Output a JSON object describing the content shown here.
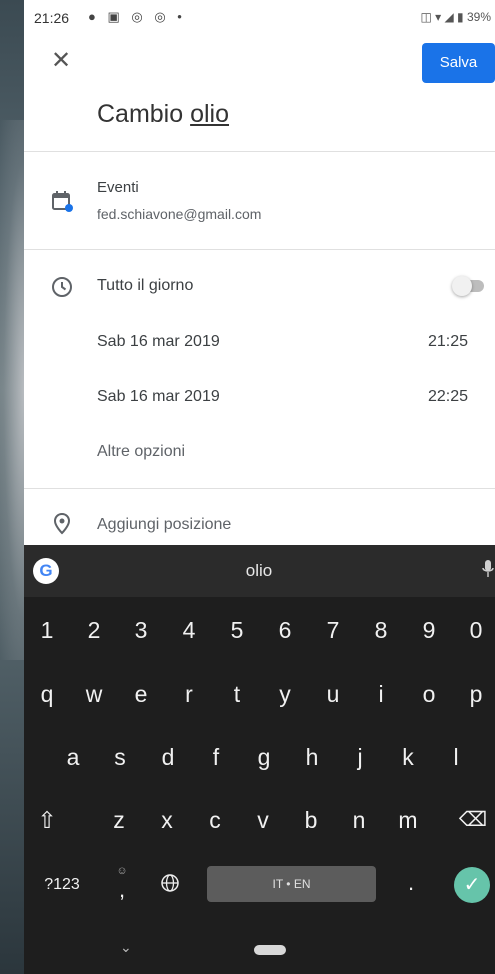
{
  "status_bar": {
    "time": "21:26",
    "left_icons": "● ▣ ◎ ◎ •",
    "right_icons": "◫ ▾ ◢ ▮ 39%"
  },
  "header": {
    "close_icon": "close-icon",
    "save_label": "Salva",
    "title_plain": "Cambio ",
    "title_underlined": "olio"
  },
  "calendar_row": {
    "icon": "calendar-icon",
    "calendar_name": "Eventi",
    "account": "fed.schiavone@gmail.com"
  },
  "time_section": {
    "icon": "clock-icon",
    "all_day_label": "Tutto il giorno",
    "all_day_on": false,
    "start_date": "Sab 16 mar 2019",
    "start_time": "21:25",
    "end_date": "Sab 16 mar 2019",
    "end_time": "22:25",
    "more_options": "Altre opzioni"
  },
  "location_row": {
    "icon": "location-pin-icon",
    "placeholder": "Aggiungi posizione"
  },
  "keyboard": {
    "suggestion": "olio",
    "google_letter": "G",
    "number_row": [
      "1",
      "2",
      "3",
      "4",
      "5",
      "6",
      "7",
      "8",
      "9",
      "0"
    ],
    "row1": [
      "q",
      "w",
      "e",
      "r",
      "t",
      "y",
      "u",
      "i",
      "o",
      "p"
    ],
    "row2": [
      "a",
      "s",
      "d",
      "f",
      "g",
      "h",
      "j",
      "k",
      "l"
    ],
    "row3": [
      "z",
      "x",
      "c",
      "v",
      "b",
      "n",
      "m"
    ],
    "symbols_key": "?123",
    "comma_key": ",",
    "emoji_hint": "☺",
    "spacebar_label": "IT • EN",
    "period_key": ".",
    "shift_icon": "⇧",
    "backspace_icon": "⌫",
    "globe_icon": "🌐",
    "enter_icon": "✓",
    "mic_icon": "🎙"
  },
  "colors": {
    "accent": "#1a73e8",
    "keyboard_bg": "#1e1e1e",
    "enter_key": "#66c4aa"
  }
}
